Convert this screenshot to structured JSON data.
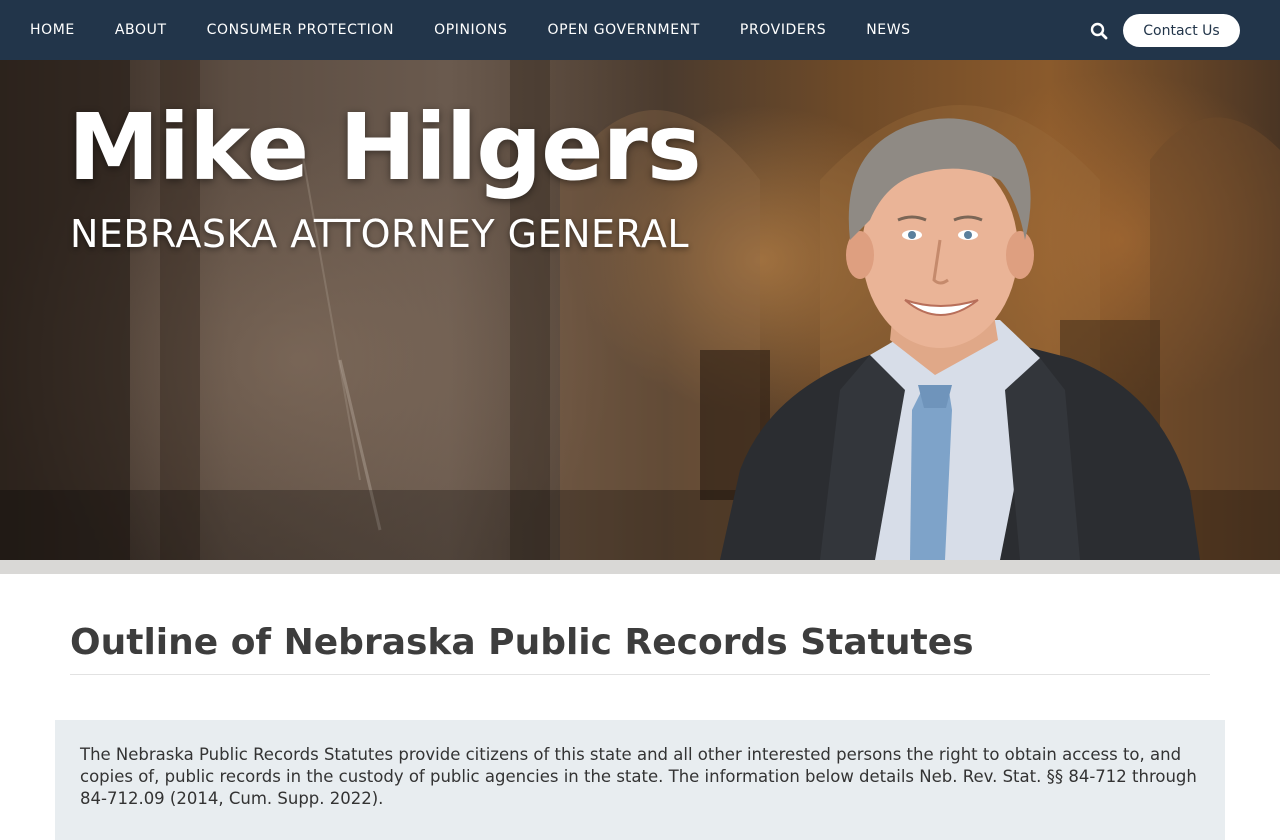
{
  "nav": {
    "items": [
      {
        "label": "HOME"
      },
      {
        "label": "ABOUT"
      },
      {
        "label": "CONSUMER PROTECTION"
      },
      {
        "label": "OPINIONS"
      },
      {
        "label": "OPEN GOVERNMENT"
      },
      {
        "label": "PROVIDERS"
      },
      {
        "label": "NEWS"
      }
    ],
    "search_icon": "search-icon",
    "contact_label": "Contact Us"
  },
  "hero": {
    "title": "Mike Hilgers",
    "subtitle": "NEBRASKA ATTORNEY GENERAL"
  },
  "content": {
    "page_title": "Outline of Nebraska Public Records Statutes",
    "intro": "The Nebraska Public Records Statutes provide citizens of this state and all other interested persons the right to obtain access to, and copies of, public records in the custody of public agencies in the state. The information below details Neb. Rev. Stat. §§ 84-712 through 84-712.09 (2014, Cum. Supp. 2022)."
  },
  "colors": {
    "nav_background": "#22354a",
    "intro_background": "#e8edf0"
  }
}
